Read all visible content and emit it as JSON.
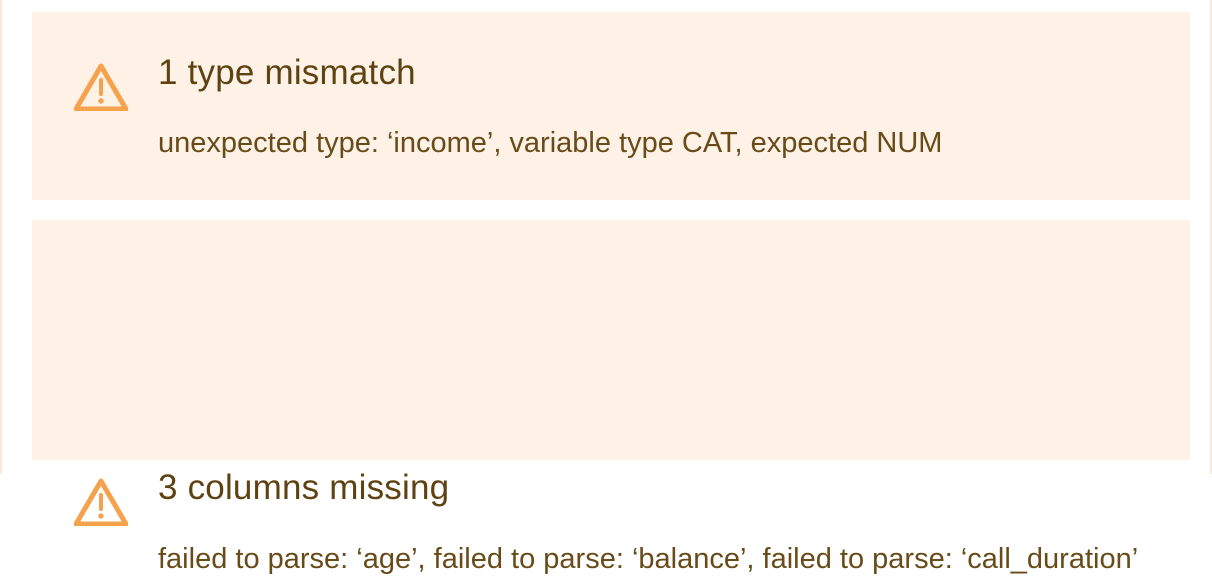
{
  "alerts": [
    {
      "icon": "warning-triangle-icon",
      "title": "1 type mismatch",
      "message": "unexpected type: ‘income’, variable type CAT, expected NUM"
    },
    {
      "icon": "warning-triangle-icon",
      "title": "3 columns missing",
      "message": "failed to parse: ‘age’, failed to parse: ‘balance’, failed to parse: ‘call_duration’"
    }
  ],
  "colors": {
    "alert_background": "#fef1e5",
    "warning_icon": "#f6a24c",
    "title_text": "#5f4212",
    "message_text": "#684b18",
    "frame_border": "#fbe9da"
  }
}
